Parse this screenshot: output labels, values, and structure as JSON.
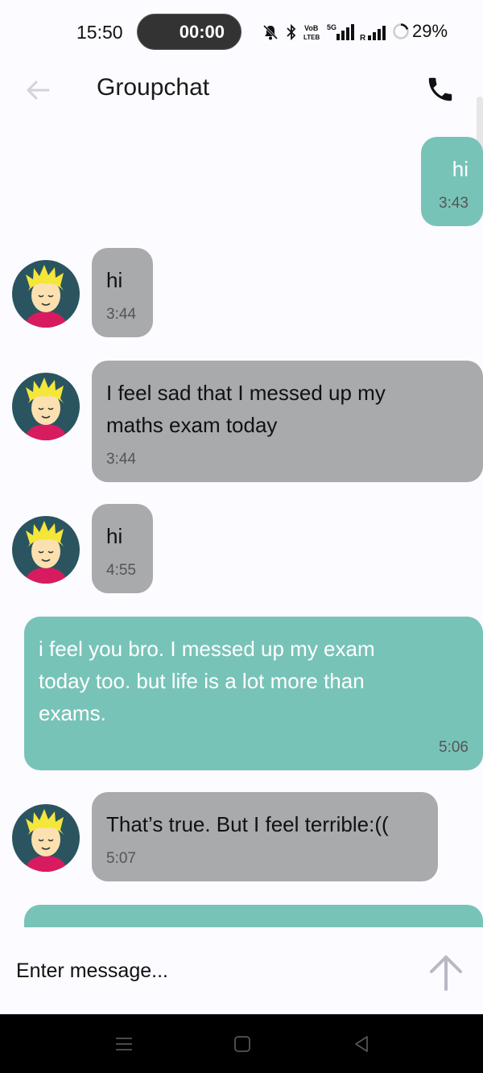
{
  "status_bar": {
    "time": "15:50",
    "call_timer": "00:00",
    "battery": "29%",
    "icons": [
      "mute-bell-icon",
      "bluetooth-icon",
      "volte-icon",
      "5g-signal-icon",
      "roaming-signal-icon",
      "battery-ring-icon"
    ],
    "volte_top": "VoB",
    "volte_bottom": "LTEB",
    "net_label": "5G",
    "roaming_label": "R"
  },
  "header": {
    "title": "Groupchat",
    "back_icon": "arrow-left-icon",
    "call_icon": "phone-icon"
  },
  "messages": [
    {
      "direction": "out",
      "text": "hi",
      "time": "3:43"
    },
    {
      "direction": "in",
      "text": "hi",
      "time": "3:44"
    },
    {
      "direction": "in",
      "text": "I feel sad that I messed up my maths exam today",
      "time": "3:44"
    },
    {
      "direction": "in",
      "text": "hi",
      "time": "4:55"
    },
    {
      "direction": "out",
      "text": "i feel you bro. I messed up my exam today too. but life is a lot more than exams.",
      "time": "5:06"
    },
    {
      "direction": "in",
      "text": "That’s true. But I feel terrible:((",
      "time": "5:07"
    },
    {
      "direction": "out",
      "text": "",
      "time": ""
    }
  ],
  "composer": {
    "placeholder": "Enter message...",
    "send_icon": "send-arrow-up-icon"
  },
  "nav_bar": {
    "icons": [
      "menu-icon",
      "home-icon",
      "back-triangle-icon"
    ]
  },
  "colors": {
    "incoming_bubble": "#a9aaac",
    "outgoing_bubble": "#78c3b8",
    "background": "#fcfbff"
  }
}
